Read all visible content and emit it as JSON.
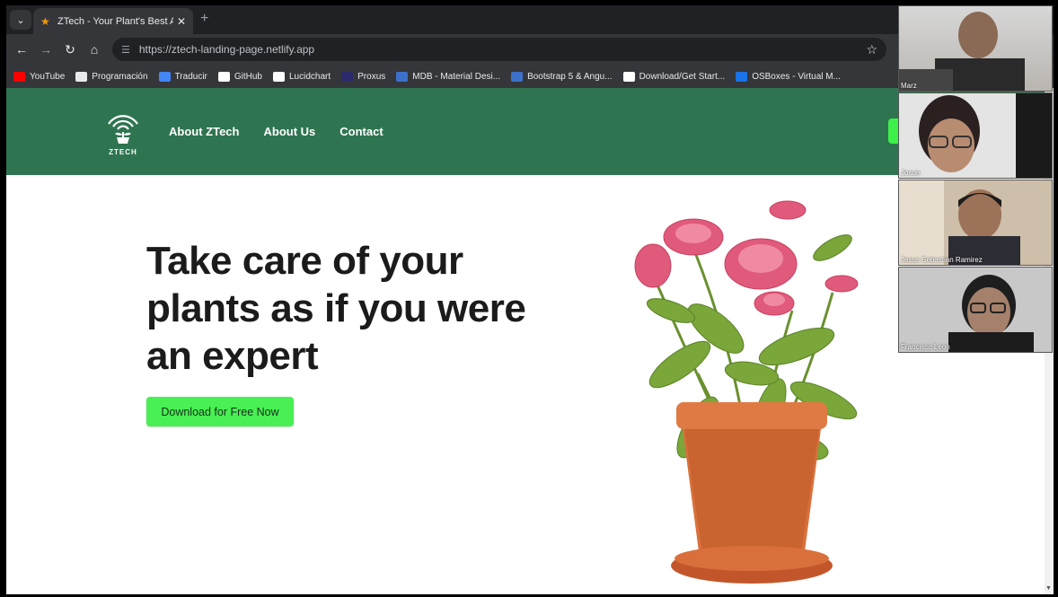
{
  "browser": {
    "tab_title": "ZTech - Your Plant's Best Ally",
    "tab_close": "✕",
    "new_tab": "+",
    "url": "https://ztech-landing-page.netlify.app",
    "bookmarks": [
      {
        "label": "YouTube",
        "icon": "youtube-icon",
        "color": "#ff0000"
      },
      {
        "label": "Programación",
        "icon": "folder-icon",
        "color": "#e8eaed"
      },
      {
        "label": "Traducir",
        "icon": "translate-icon",
        "color": "#4285f4"
      },
      {
        "label": "GitHub",
        "icon": "github-icon",
        "color": "#ffffff"
      },
      {
        "label": "Lucidchart",
        "icon": "lucidchart-icon",
        "color": "#ffffff"
      },
      {
        "label": "Proxus",
        "icon": "proxus-icon",
        "color": "#2b2b6b"
      },
      {
        "label": "MDB - Material Desi...",
        "icon": "mdb-icon",
        "color": "#3b71ca"
      },
      {
        "label": "Bootstrap 5 & Angu...",
        "icon": "mdb-icon",
        "color": "#3b71ca"
      },
      {
        "label": "Download/Get Start...",
        "icon": "medium-icon",
        "color": "#ffffff"
      },
      {
        "label": "OSBoxes - Virtual M...",
        "icon": "osboxes-icon",
        "color": "#1a73e8"
      }
    ]
  },
  "site": {
    "logo_text": "ZTECH",
    "nav": [
      "About ZTech",
      "About Us",
      "Contact"
    ],
    "hero_title": "Take care of your plants as if you were an expert",
    "cta": "Download for Free Now",
    "colors": {
      "header": "#2f7450",
      "button": "#48f053"
    }
  },
  "call": {
    "participants": [
      "Marz",
      "Josue",
      "Jesus Sebastian Ramirez",
      "Francisco Leon"
    ]
  }
}
